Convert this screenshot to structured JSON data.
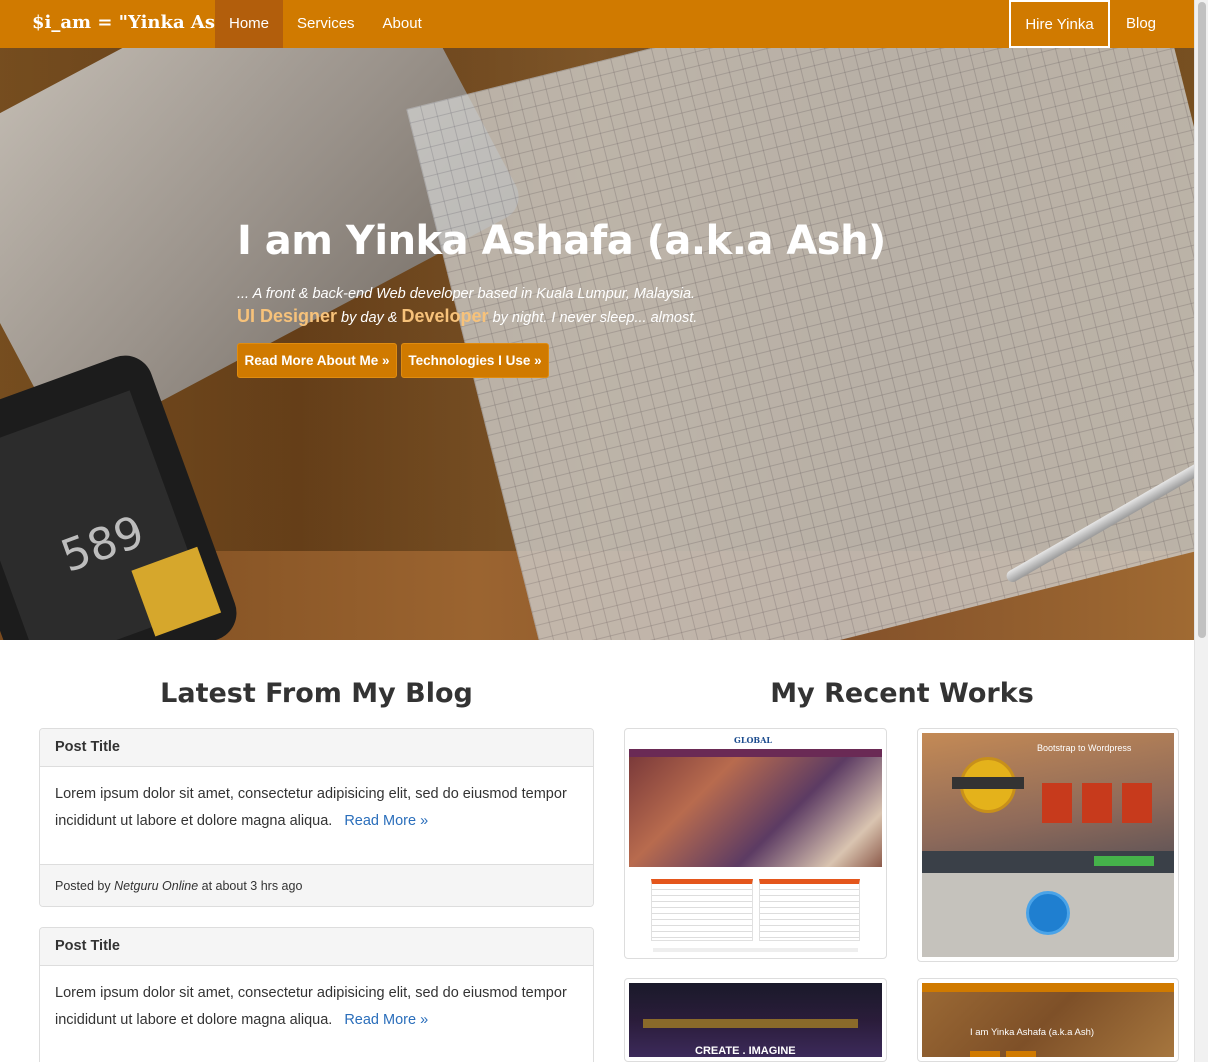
{
  "brand": "$i_am = \"Yinka Ash\"",
  "nav": {
    "items": [
      {
        "label": "Home",
        "active": true
      },
      {
        "label": "Services",
        "active": false
      },
      {
        "label": "About",
        "active": false
      }
    ],
    "hire_label": "Hire Yinka",
    "blog_label": "Blog"
  },
  "colors": {
    "accent": "#d07a00",
    "nav_active": "#b25e0c",
    "link": "#2a6ebb"
  },
  "hero": {
    "title": "I am Yinka Ashafa (a.k.a Ash)",
    "subtitle_line1": "... A front & back-end Web developer based in Kuala Lumpur, Malaysia.",
    "highlight1": "UI Designer",
    "text_by_day": " by day & ",
    "highlight2": "Developer",
    "text_by_night": " by night. I never sleep... almost.",
    "btn_read_more": "Read More About Me »",
    "btn_technologies": "Technologies I Use »",
    "phone_display": "589"
  },
  "blog": {
    "heading": "Latest From My Blog",
    "posts": [
      {
        "title": "Post Title",
        "body": "Lorem ipsum dolor sit amet, consectetur adipisicing elit, sed do eiusmod tempor incididunt ut labore et dolore magna aliqua.",
        "read_more": "Read More »",
        "posted_by": "Posted by ",
        "author": "Netguru Online",
        "time": " at about 3 hrs ago"
      },
      {
        "title": "Post Title",
        "body": "Lorem ipsum dolor sit amet, consectetur adipisicing elit, sed do eiusmod tempor incididunt ut labore et dolore magna aliqua.",
        "read_more": "Read More »"
      }
    ]
  },
  "works": {
    "heading": "My Recent Works",
    "items": [
      {
        "logo_text": "GLOBAL"
      },
      {
        "title": "Bootstrap to Wordpress"
      },
      {
        "caption": "CREATE . IMAGINE"
      },
      {
        "caption": "I am Yinka Ashafa (a.k.a Ash)"
      }
    ]
  }
}
